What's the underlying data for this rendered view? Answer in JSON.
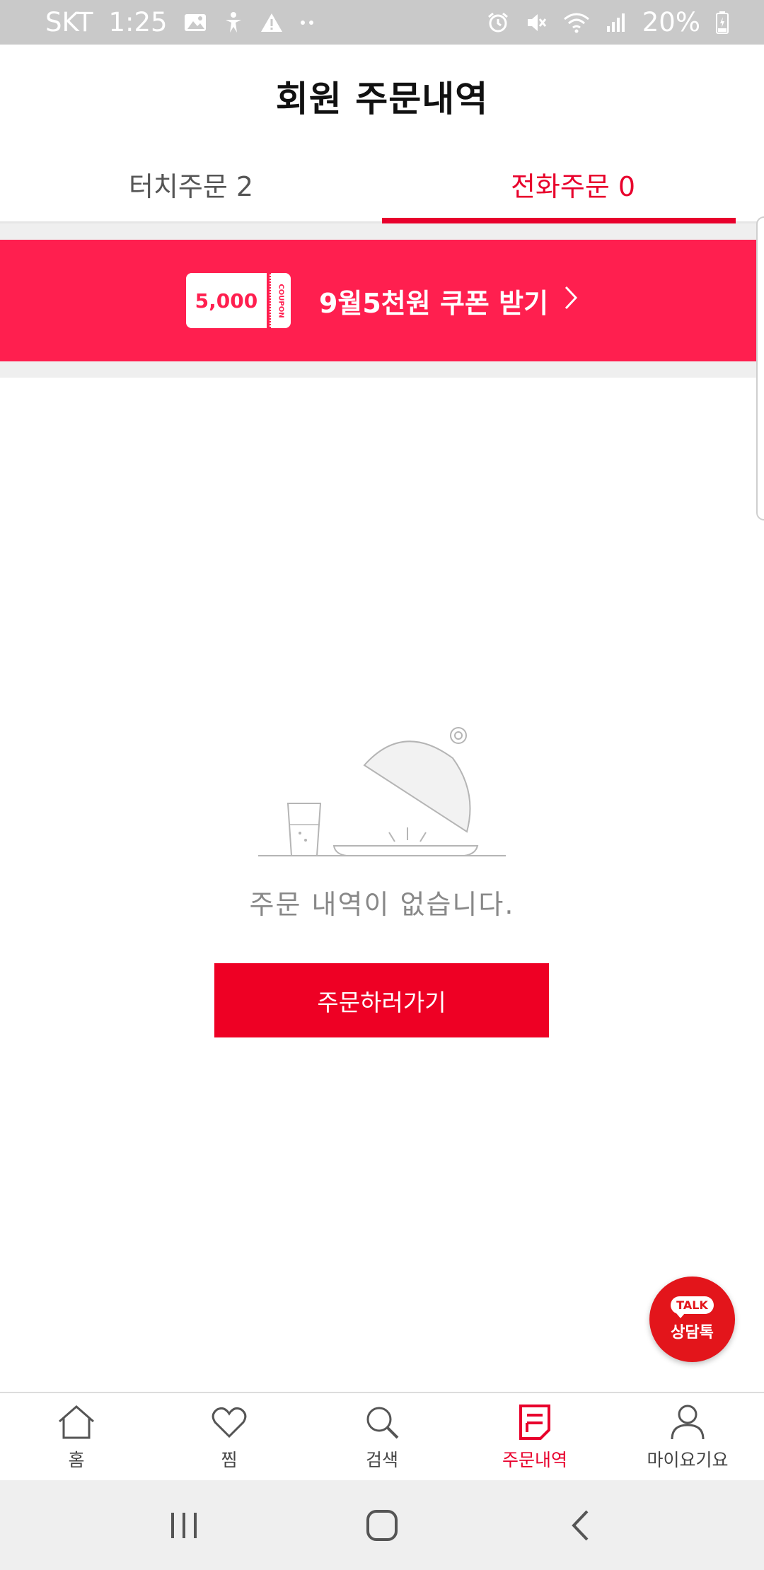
{
  "status_bar": {
    "carrier": "SKT",
    "time": "1:25",
    "battery": "20%",
    "icons": [
      "image-icon",
      "accessibility-icon",
      "warning-icon",
      "more-dots-icon",
      "alarm-icon",
      "mute-icon",
      "wifi-icon",
      "signal-icon",
      "battery-icon"
    ]
  },
  "header": {
    "title": "회원 주문내역"
  },
  "tabs": [
    {
      "label": "터치주문 2",
      "active": false
    },
    {
      "label": "전화주문 0",
      "active": true
    }
  ],
  "coupon_banner": {
    "amount": "5,000",
    "stub": "COUPON",
    "text": "9월5천원 쿠폰 받기",
    "arrow_icon": "chevron-right-icon"
  },
  "empty_state": {
    "illustration": "empty-cloche-icon",
    "message": "주문 내역이 없습니다.",
    "button_label": "주문하러가기"
  },
  "talk_fab": {
    "badge": "TALK",
    "label": "상담톡"
  },
  "bottom_nav": [
    {
      "label": "홈",
      "icon": "home-icon",
      "active": false
    },
    {
      "label": "찜",
      "icon": "heart-icon",
      "active": false
    },
    {
      "label": "검색",
      "icon": "search-icon",
      "active": false
    },
    {
      "label": "주문내역",
      "icon": "order-list-icon",
      "active": true
    },
    {
      "label": "마이요기요",
      "icon": "user-icon",
      "active": false
    }
  ],
  "colors": {
    "accent": "#e8002c",
    "banner": "#ff1f4f",
    "talk": "#e3151b",
    "status_bar": "#c9c9c9"
  }
}
